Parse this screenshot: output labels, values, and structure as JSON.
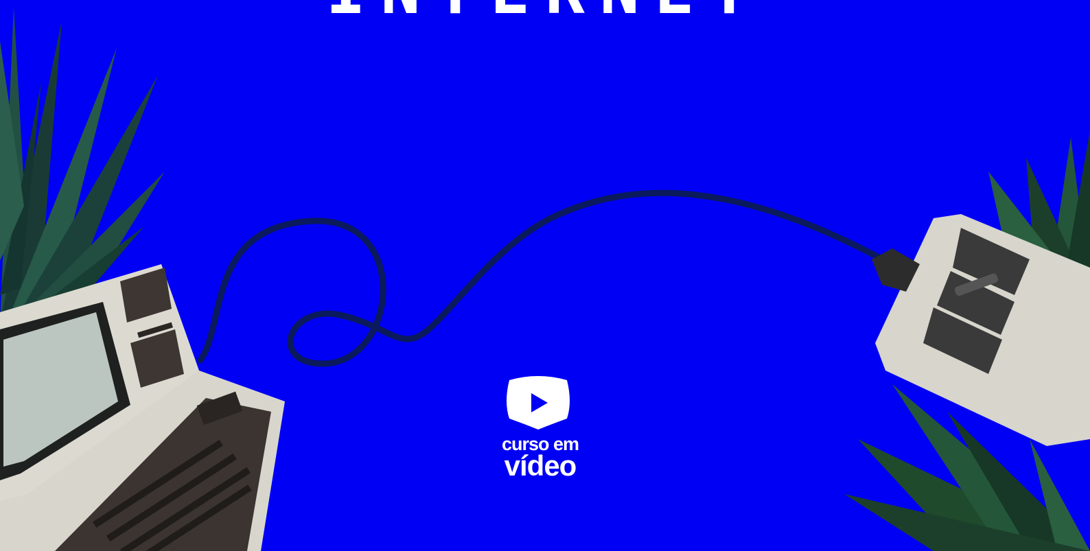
{
  "hero": {
    "title": "INTERNET"
  },
  "logo": {
    "line1": "curso em",
    "line2": "vídeo",
    "icon": "play-icon"
  },
  "illustration": {
    "computer": "retro-computer-icon",
    "mouse": "retro-mouse-icon",
    "cable": "cable-icon",
    "plants": "palm-leaves-icon"
  },
  "colors": {
    "background": "#0000f5",
    "cable": "#0a1a5c",
    "device_body": "#d8d6cc",
    "device_dark": "#3a3a3a",
    "plant": "#1f4a2c",
    "text": "#ffffff"
  }
}
